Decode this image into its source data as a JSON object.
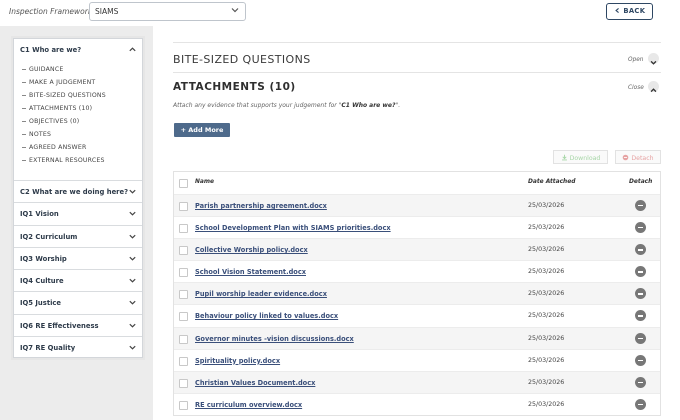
{
  "framework": {
    "label": "Inspection Framework:",
    "selected": "SIAMS"
  },
  "header": {
    "back_label": "BACK"
  },
  "sidebar": {
    "open_section": {
      "title": "C1 Who are we?",
      "subitems": [
        "GUIDANCE",
        "MAKE A JUDGEMENT",
        "BITE-SIZED QUESTIONS",
        "ATTACHMENTS (10)",
        "OBJECTIVES (0)",
        "NOTES",
        "AGREED ANSWER",
        "EXTERNAL RESOURCES"
      ]
    },
    "items": [
      "C2 What are we doing here?",
      "IQ1 Vision",
      "IQ2 Curriculum",
      "IQ3 Worship",
      "IQ4 Culture",
      "IQ5 Justice",
      "IQ6 RE Effectiveness",
      "IQ7 RE Quality"
    ]
  },
  "main": {
    "bsq_title": "BITE-SIZED QUESTIONS",
    "open_label": "Open",
    "attachments_title": "ATTACHMENTS (10)",
    "close_label": "Close",
    "note_prefix": "Attach any evidence that supports your judgement for \"",
    "note_bold": "C1 Who are we?",
    "note_suffix": "\".",
    "add_more_label": "+ Add More",
    "download_label": "Download",
    "detach_label": "Detach"
  },
  "table": {
    "headers": {
      "name": "Name",
      "date": "Date Attached",
      "detach": "Detach"
    },
    "rows": [
      {
        "name": "Parish partnership agreement.docx",
        "date": "25/03/2026"
      },
      {
        "name": "School Development Plan with SIAMS priorities.docx",
        "date": "25/03/2026"
      },
      {
        "name": "Collective Worship policy.docx",
        "date": "25/03/2026"
      },
      {
        "name": "School Vision Statement.docx",
        "date": "25/03/2026"
      },
      {
        "name": "Pupil worship leader evidence.docx",
        "date": "25/03/2026"
      },
      {
        "name": "Behaviour policy linked to values.docx",
        "date": "25/03/2026"
      },
      {
        "name": "Governor minutes -vision discussions.docx",
        "date": "25/03/2026"
      },
      {
        "name": "Spirituality policy.docx",
        "date": "25/03/2026"
      },
      {
        "name": "Christian Values Document.docx",
        "date": "25/03/2026"
      },
      {
        "name": "RE curriculum overview.docx",
        "date": "25/03/2026"
      }
    ]
  },
  "colors": {
    "accent": "#4e6a8b",
    "link": "#3a4f7a",
    "download": "#a7d6a7",
    "detach": "#e6a3a3"
  },
  "icons": [
    "chevron-down-icon",
    "chevron-up-icon",
    "download-icon",
    "detach-icon",
    "remove-icon"
  ]
}
